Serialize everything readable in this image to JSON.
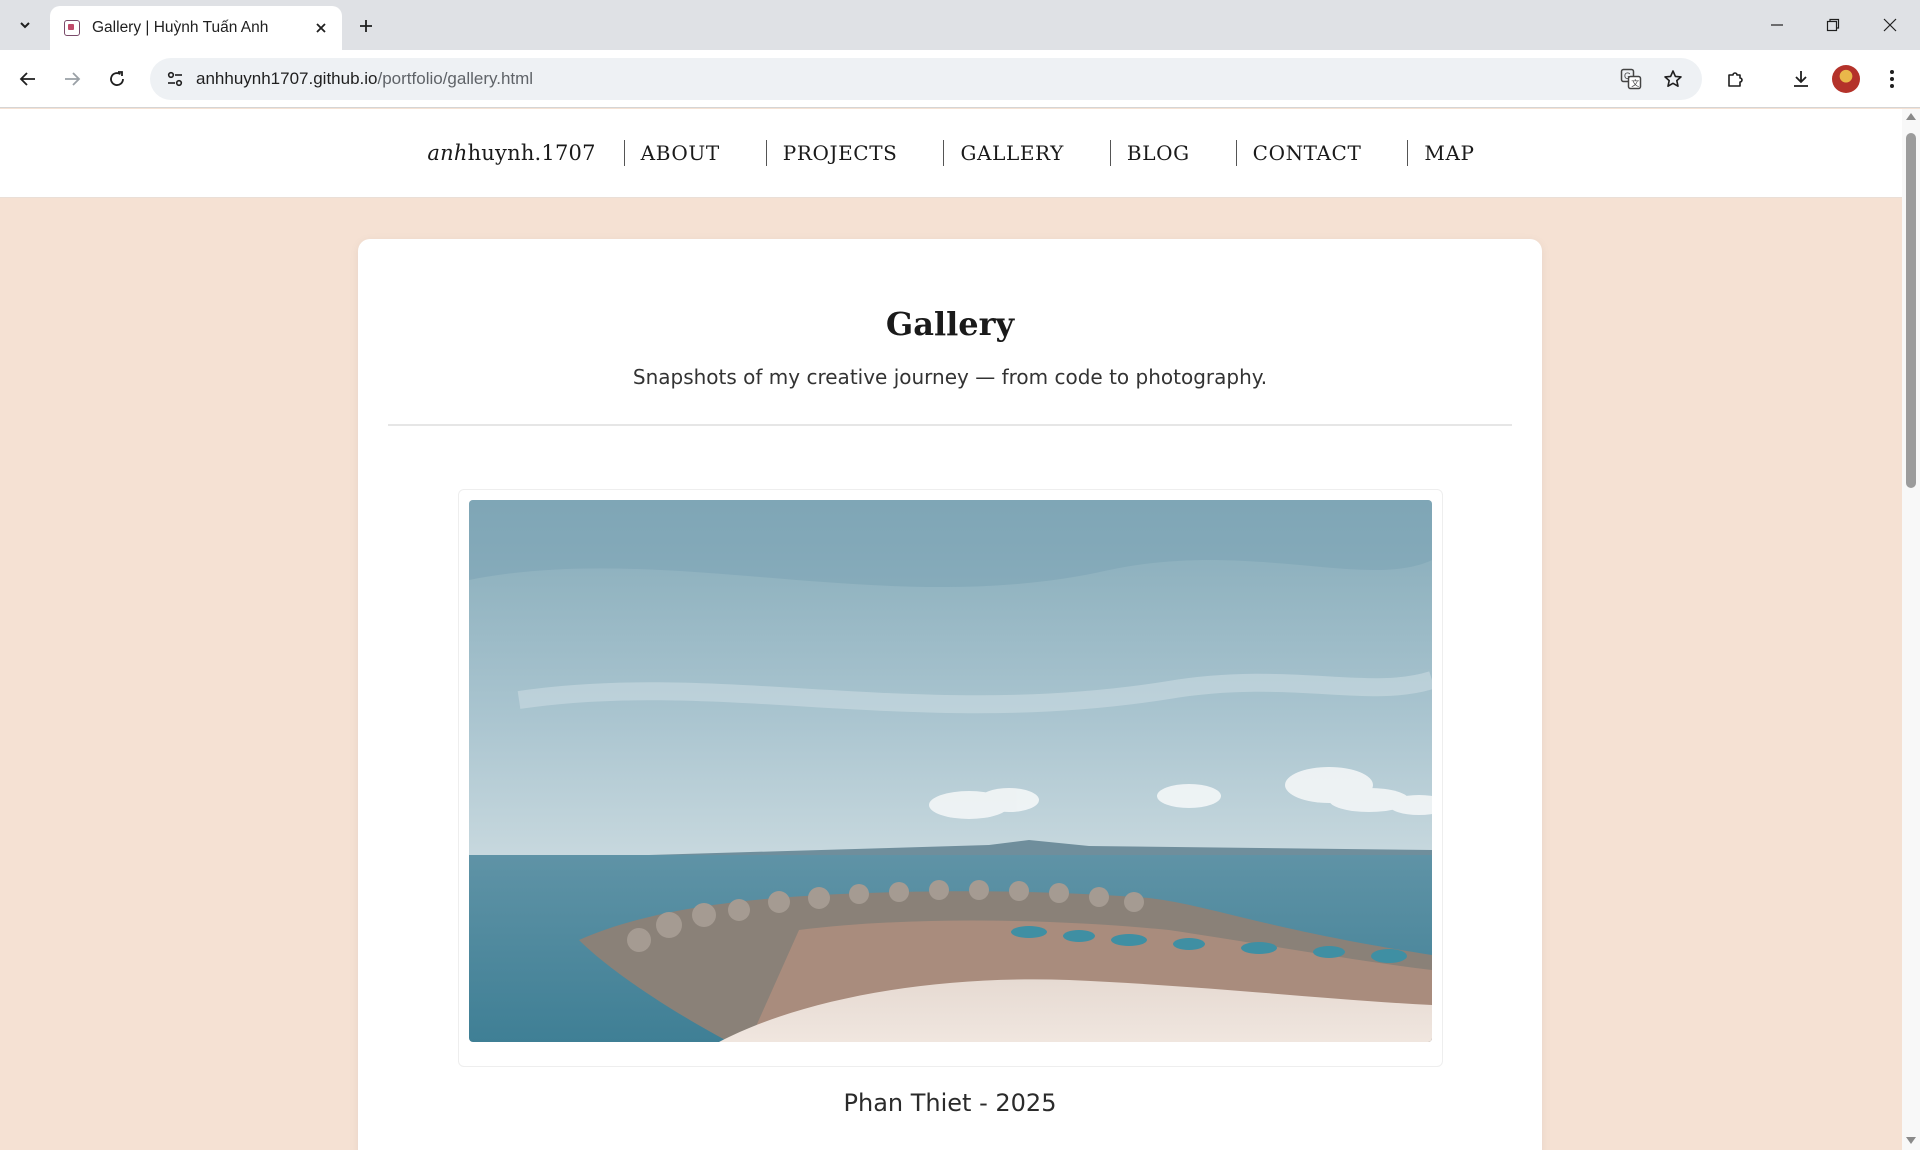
{
  "browser": {
    "tab_title": "Gallery | Huỳnh Tuấn Anh",
    "url_host": "anhhuynh1707.github.io",
    "url_path": "/portfolio/gallery.html"
  },
  "site_nav": {
    "brand_italic": "anh",
    "brand_rest": "huynh.1707",
    "links": [
      "ABOUT",
      "PROJECTS",
      "GALLERY",
      "BLOG",
      "CONTACT",
      "MAP"
    ]
  },
  "gallery": {
    "title": "Gallery",
    "subtitle": "Snapshots of my creative journey — from code to photography.",
    "items": [
      {
        "caption": "Phan Thiet - 2025"
      }
    ]
  },
  "colors": {
    "page_background": "#f5e1d3",
    "card_background": "#ffffff",
    "tabstrip": "#dfe1e5"
  }
}
